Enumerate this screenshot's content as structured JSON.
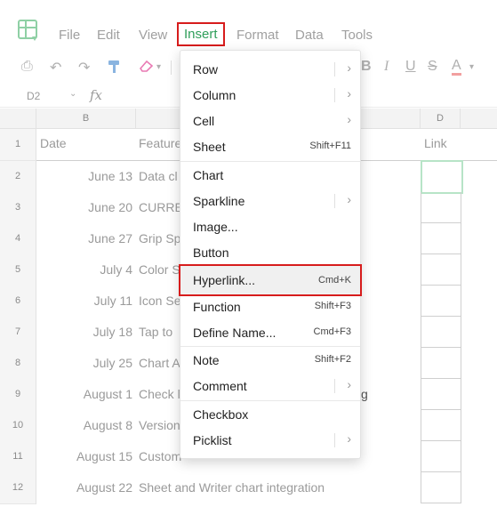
{
  "menubar": {
    "items": [
      "File",
      "Edit",
      "View",
      "Insert",
      "Format",
      "Data",
      "Tools"
    ],
    "active": "Insert"
  },
  "formula_bar": {
    "name_box": "D2",
    "fx_label": "fx"
  },
  "toolbar": {
    "bold": "B",
    "italic": "I",
    "underline": "U",
    "strike": "S",
    "font_color": "A"
  },
  "grid": {
    "col_headers": [
      "B",
      "D"
    ],
    "header_row": {
      "date": "Date",
      "feature": "Feature",
      "link": "Link"
    },
    "row_numbers": [
      "1",
      "2",
      "3",
      "4",
      "5",
      "6",
      "7",
      "8",
      "9",
      "10",
      "11",
      "12"
    ],
    "rows": [
      {
        "date": "June 13",
        "feature": "Data cl"
      },
      {
        "date": "June 20",
        "feature": "CURREI"
      },
      {
        "date": "June 27",
        "feature": "Grip Sp"
      },
      {
        "date": "July 4",
        "feature": "Color S"
      },
      {
        "date": "July 11",
        "feature": "Icon Se"
      },
      {
        "date": "July 18",
        "feature": "Tap to"
      },
      {
        "date": "July 25",
        "feature": "Chart A"
      },
      {
        "date": "August 1",
        "feature": "Check l"
      },
      {
        "date": "August 8",
        "feature": "Version"
      },
      {
        "date": "August 15",
        "feature": "Custom"
      },
      {
        "date": "August 22",
        "feature": "Sheet and Writer chart integration"
      }
    ],
    "peek_text": "g"
  },
  "insert_menu": {
    "items": [
      {
        "label": "Row",
        "shortcut": "",
        "submenu": true
      },
      {
        "label": "Column",
        "shortcut": "",
        "submenu": true
      },
      {
        "label": "Cell",
        "shortcut": "",
        "submenu": true
      },
      {
        "label": "Sheet",
        "shortcut": "Shift+F11",
        "submenu": false
      },
      {
        "label": "Chart",
        "shortcut": "",
        "submenu": false
      },
      {
        "label": "Sparkline",
        "shortcut": "",
        "submenu": true
      },
      {
        "label": "Image...",
        "shortcut": "",
        "submenu": false
      },
      {
        "label": "Button",
        "shortcut": "",
        "submenu": false
      },
      {
        "label": "Hyperlink...",
        "shortcut": "Cmd+K",
        "submenu": false
      },
      {
        "label": "Function",
        "shortcut": "Shift+F3",
        "submenu": false
      },
      {
        "label": "Define Name...",
        "shortcut": "Cmd+F3",
        "submenu": false
      },
      {
        "label": "Note",
        "shortcut": "Shift+F2",
        "submenu": false
      },
      {
        "label": "Comment",
        "shortcut": "",
        "submenu": true
      },
      {
        "label": "Checkbox",
        "shortcut": "",
        "submenu": false
      },
      {
        "label": "Picklist",
        "shortcut": "",
        "submenu": true
      }
    ],
    "highlighted": "Hyperlink..."
  },
  "colors": {
    "accent": "#2f9e5a",
    "highlight_border": "#d71c1c"
  }
}
